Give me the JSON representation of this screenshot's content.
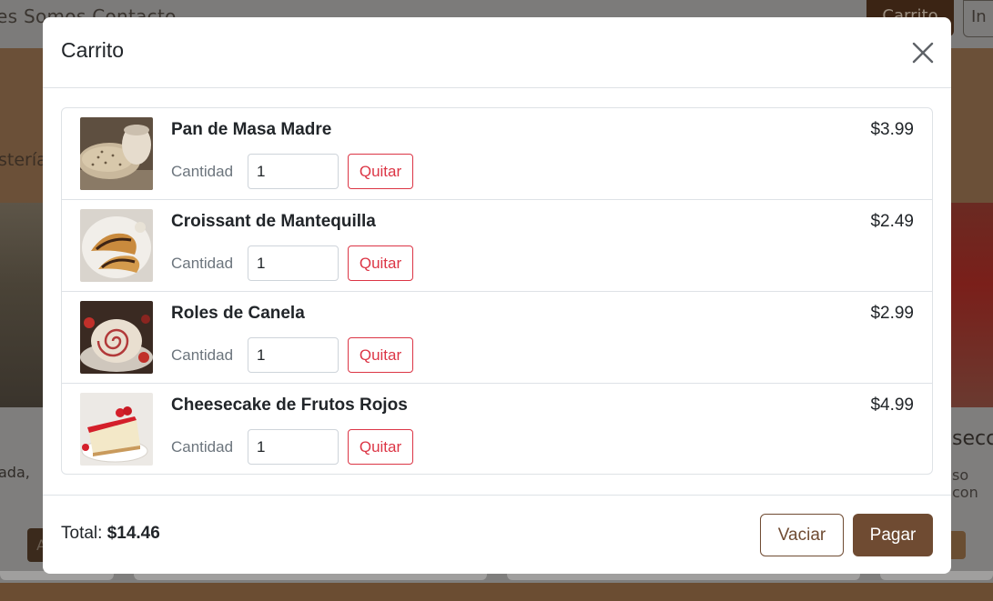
{
  "background": {
    "nav_text": "es Somos    Contacto",
    "cart_button": "Carrito",
    "login_button": "In",
    "hero_text": "stería",
    "card_text_left": "ada,",
    "card_title_right": "secc",
    "card_text_right": "so con",
    "card_button_left": "A"
  },
  "modal": {
    "title": "Carrito",
    "close_icon": "close-icon",
    "items": [
      {
        "name": "Pan de Masa Madre",
        "qty_label": "Cantidad",
        "qty": "1",
        "remove_label": "Quitar",
        "price": "$3.99",
        "image": "sourdough-bread"
      },
      {
        "name": "Croissant de Mantequilla",
        "qty_label": "Cantidad",
        "qty": "1",
        "remove_label": "Quitar",
        "price": "$2.49",
        "image": "croissant"
      },
      {
        "name": "Roles de Canela",
        "qty_label": "Cantidad",
        "qty": "1",
        "remove_label": "Quitar",
        "price": "$2.99",
        "image": "cinnamon-roll"
      },
      {
        "name": "Cheesecake de Frutos Rojos",
        "qty_label": "Cantidad",
        "qty": "1",
        "remove_label": "Quitar",
        "price": "$4.99",
        "image": "cheesecake"
      }
    ],
    "total_label": "Total:",
    "total_value": "$14.46",
    "empty_label": "Vaciar",
    "pay_label": "Pagar"
  },
  "colors": {
    "accent": "#6f4b32",
    "danger": "#dc3545",
    "backdrop": "#8b8a89"
  }
}
